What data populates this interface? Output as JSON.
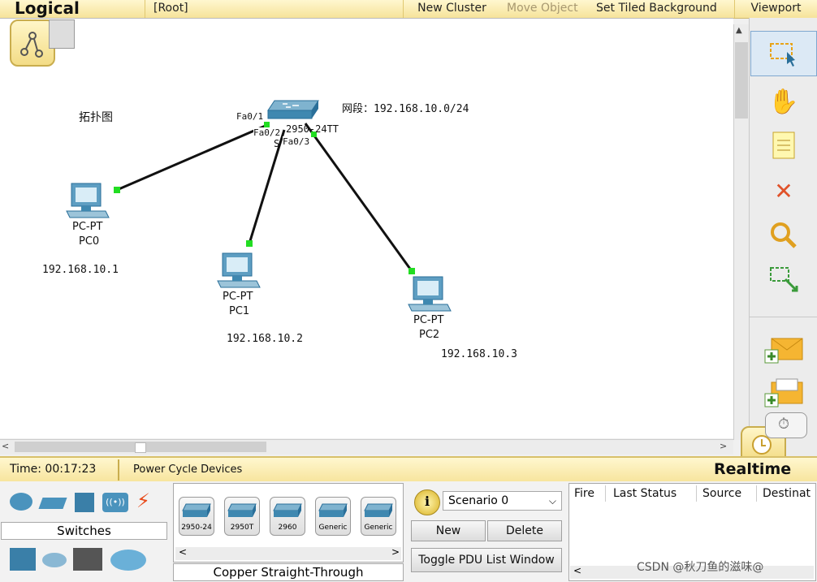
{
  "topbar": {
    "title": "Logical",
    "root": "[Root]",
    "new_cluster": "New Cluster",
    "move_object": "Move Object",
    "set_tiled_background": "Set Tiled Background",
    "viewport": "Viewport"
  },
  "canvas": {
    "topology_label": "拓扑图",
    "segment_label": "网段：192.168.10.0/24",
    "switch": {
      "model_text": "2950-24TT",
      "name_text": "S"
    },
    "ports": {
      "fa01": "Fa0/1",
      "fa02": "Fa0/2",
      "fa03": "Fa0/3"
    },
    "devices": [
      {
        "type": "PC-PT",
        "name": "PC0",
        "ip": "192.168.10.1"
      },
      {
        "type": "PC-PT",
        "name": "PC1",
        "ip": "192.168.10.2"
      },
      {
        "type": "PC-PT",
        "name": "PC2",
        "ip": "192.168.10.3"
      }
    ],
    "link_color": "#111111",
    "link_end_color": "#22dd22"
  },
  "status": {
    "time": "Time: 00:17:23",
    "power_cycle": "Power Cycle Devices",
    "mode": "Realtime"
  },
  "devices_panel": {
    "category": "Switches",
    "connection": "Copper Straight-Through",
    "models": [
      "2950-24",
      "2950T",
      "2960",
      "Generic",
      "Generic"
    ]
  },
  "scenario": {
    "selected": "Scenario 0",
    "new": "New",
    "delete": "Delete",
    "toggle": "Toggle PDU List Window",
    "info": "i"
  },
  "pdu_table": {
    "columns": [
      "Fire",
      "Last Status",
      "Source",
      "Destinat"
    ]
  },
  "watermark": "CSDN @秋刀鱼的滋味@",
  "colors": {
    "toolbar_bg": "#f6e39a",
    "accent": "#2a6f99"
  }
}
